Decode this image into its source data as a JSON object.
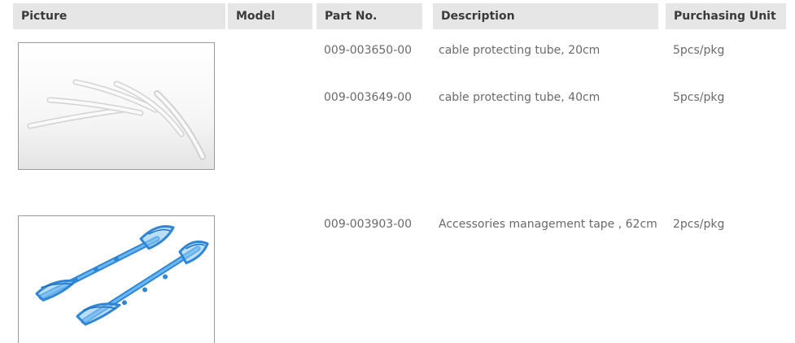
{
  "header": {
    "picture": "Picture",
    "model": "Model",
    "part_no": "Part No.",
    "description": "Description",
    "purchasing_unit": "Purchasing Unit"
  },
  "rows": [
    {
      "image": "cable-protecting-tubes-photo",
      "model": "",
      "part_no": "009-003650-00",
      "description": "cable protecting tube, 20cm",
      "purchasing_unit": "5pcs/pkg"
    },
    {
      "image": "cable-protecting-tubes-photo",
      "model": "",
      "part_no": "009-003649-00",
      "description": "cable protecting tube, 40cm",
      "purchasing_unit": "5pcs/pkg"
    },
    {
      "image": "management-tape-photo",
      "model": "",
      "part_no": "009-003903-00",
      "description": "Accessories management tape , 62cm",
      "purchasing_unit": "2pcs/pkg"
    }
  ],
  "colors": {
    "header_bg": "#e6e6e6",
    "header_text": "#3a3a3a",
    "body_text": "#6a6a6a",
    "frame_border": "#9a9a9a",
    "tape_blue": "#3e9be6"
  }
}
